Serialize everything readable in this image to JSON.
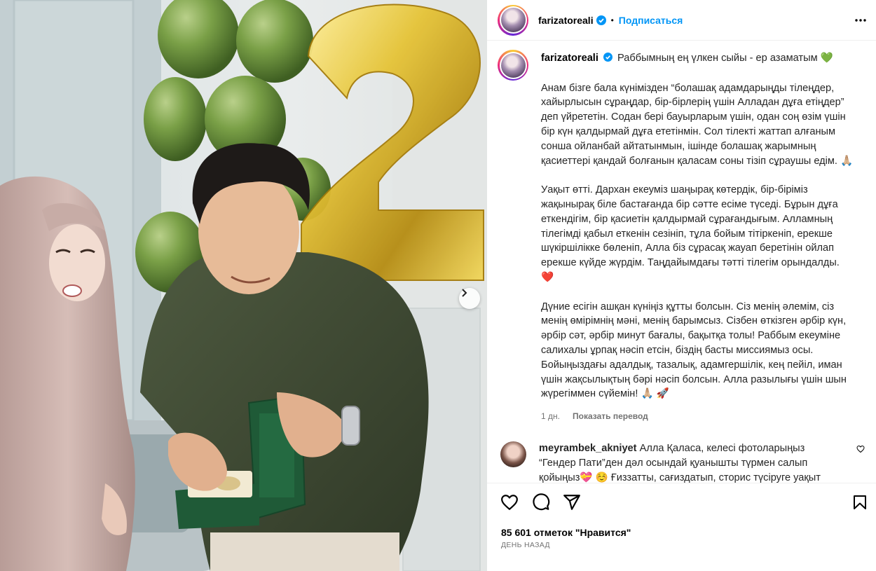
{
  "post": {
    "username": "farizatoreali",
    "follow_label": "Подписаться",
    "separator": "•"
  },
  "caption": {
    "username": "farizatoreali",
    "first_line": "Раббымның ең үлкен сыйы - ер азаматым",
    "first_emoji": "💚",
    "paragraph_1": "Анам бізге бала күнімізден “болашақ адамдарыңды тілеңдер, хайырлысын сұраңдар, бір-бірлерің үшін Алладан дұға етіңдер” деп үйрететін. Содан бері бауырларым үшін, одан соң өзім үшін бір күн қалдырмай дұға ететінмін. Сол тілекті жаттап алғаным сонша ойланбай айтатынмын, ішінде болашақ жарымның қасиеттері қандай болғанын қаласам соны тізіп сұраушы едім.",
    "paragraph_1_emoji": "🙏🏼",
    "paragraph_2": "Уақыт өтті. Дархан екеуміз шаңырақ көтердік, бір-біріміз жақынырақ біле бастағанда бір сәтте есіме түседі. Бұрын дұға еткендігім, бір қасиетін қалдырмай сұрағандығым. Алламның тілегімді қабыл еткенін сезініп, тұла бойым тітіркеніп, ерекше шүкіршілікке бөленіп, Алла біз сұрасақ жауап беретінін ойлап ерекше күйде жүрдім. Таңдайымдағы тәтті тілегім орындалды.",
    "paragraph_2_emoji": "❤️",
    "paragraph_3": "Дүние есігін ашқан күніңіз құтты болсын. Сіз менің әлемім, сіз менің өмірімнің мәні, менің барымсыз. Сізбен өткізген әрбір күн, әрбір сәт, әрбір минут бағалы, бақытқа толы! Раббым екеуміне салихалы ұрпақ нәсіп етсін, біздің басты миссиямыз осы. Бойыңыздағы адалдық, тазалық, адамгершілік, кең пейіл, иман үшін жақсылықтың бәрі нәсіп болсын. Алла разылығы үшін шын жүрегіммен сүйемін!",
    "paragraph_3_emoji": "🙏🏼 🚀",
    "time": "1 дн.",
    "translate_label": "Показать перевод"
  },
  "comment": {
    "username": "meyrambek_akniyet",
    "text_line1": "Алла Қаласа, келесі фотоларыңыз",
    "text_line2": "“Гендер Пати”ден дәл осындай қуанышты түрмен салып",
    "text_line3": "қойыңыз💝 ☺️ Ғиззатты, сағиздатып, сторис түсіруге уақыт"
  },
  "stats": {
    "likes": "85 601 отметок \"Нравится\"",
    "posted": "ДЕНЬ НАЗАД"
  },
  "colors": {
    "accent_blue": "#0095f6",
    "balloon_green": "#6f9640",
    "balloon_gold": "#d8b52a",
    "shirt": "#3f4a33",
    "hijab": "#cdb3ad",
    "box_green": "#1f5a37"
  },
  "icons": {
    "verified": "verified-badge-icon",
    "more": "more-horizontal-icon",
    "like": "heart-outline-icon",
    "comment": "comment-bubble-icon",
    "share": "paper-plane-icon",
    "save": "bookmark-icon",
    "next": "chevron-right-icon"
  }
}
